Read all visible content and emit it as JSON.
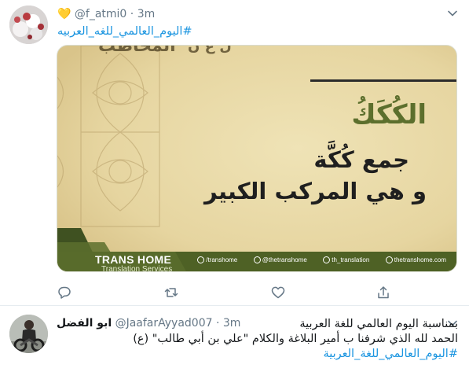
{
  "tweet1": {
    "emoji": "💛",
    "handle": "@f_atmi0",
    "separator": "·",
    "time": "3m",
    "hashtag": "#اليوم_العالمي_للغه_العربيه",
    "media": {
      "top_text": "المخاطب",
      "top_text_small": "ل ع ن",
      "heading": "الكُكَكُ",
      "line1": "جمع كُكَّة",
      "line2": "و هي المركب الكبير",
      "brand": "TRANS HOME",
      "brand_sub": "Translation Services",
      "social_fb": "/transhome",
      "social_tw": "@thetranshome",
      "social_ig": "th_translation",
      "social_web": "thetranshome.com"
    },
    "actions": [
      "reply-icon",
      "retweet-icon",
      "like-icon",
      "share-icon"
    ]
  },
  "tweet2": {
    "name": "ابو الفضل",
    "handle": "@JaafarAyyad007",
    "separator": "·",
    "time": "3m",
    "line1": "بمناسبة اليوم العالمي للغة العربية",
    "line2": "الحمد لله الذي شرفنا ب  أمير البلاغة والكلام \"علي بن أبي طالب\" (ع)",
    "hashtag": "#اليوم_العالمي_للغة_العربية"
  },
  "colors": {
    "accent": "#1b95e0",
    "secondary_text": "#657786",
    "media_background": "#e9dcaa",
    "media_green": "#5c6f2d"
  }
}
